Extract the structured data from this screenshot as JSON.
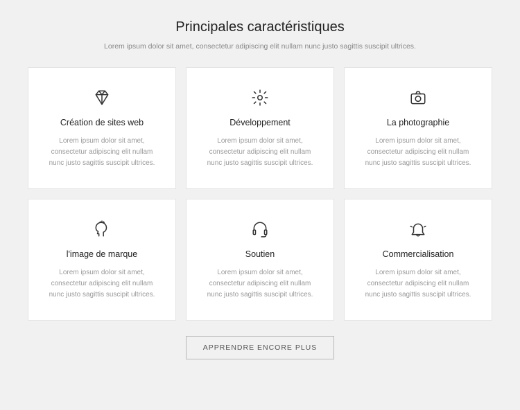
{
  "header": {
    "title": "Principales caractéristiques",
    "subtitle": "Lorem ipsum dolor sit amet, consectetur adipiscing elit nullam nunc justo sagittis suscipit ultrices."
  },
  "cards": [
    {
      "icon": "diamond-icon",
      "title": "Création de sites web",
      "desc": "Lorem ipsum dolor sit amet, consectetur adipiscing elit nullam nunc justo sagittis suscipit ultrices."
    },
    {
      "icon": "gear-icon",
      "title": "Développement",
      "desc": "Lorem ipsum dolor sit amet, consectetur adipiscing elit nullam nunc justo sagittis suscipit ultrices."
    },
    {
      "icon": "camera-icon",
      "title": "La photographie",
      "desc": "Lorem ipsum dolor sit amet, consectetur adipiscing elit nullam nunc justo sagittis suscipit ultrices."
    },
    {
      "icon": "head-ideas-icon",
      "title": "l'image de marque",
      "desc": "Lorem ipsum dolor sit amet, consectetur adipiscing elit nullam nunc justo sagittis suscipit ultrices."
    },
    {
      "icon": "headset-icon",
      "title": "Soutien",
      "desc": "Lorem ipsum dolor sit amet, consectetur adipiscing elit nullam nunc justo sagittis suscipit ultrices."
    },
    {
      "icon": "bell-icon",
      "title": "Commercialisation",
      "desc": "Lorem ipsum dolor sit amet, consectetur adipiscing elit nullam nunc justo sagittis suscipit ultrices."
    }
  ],
  "cta": {
    "label": "APPRENDRE ENCORE PLUS"
  }
}
